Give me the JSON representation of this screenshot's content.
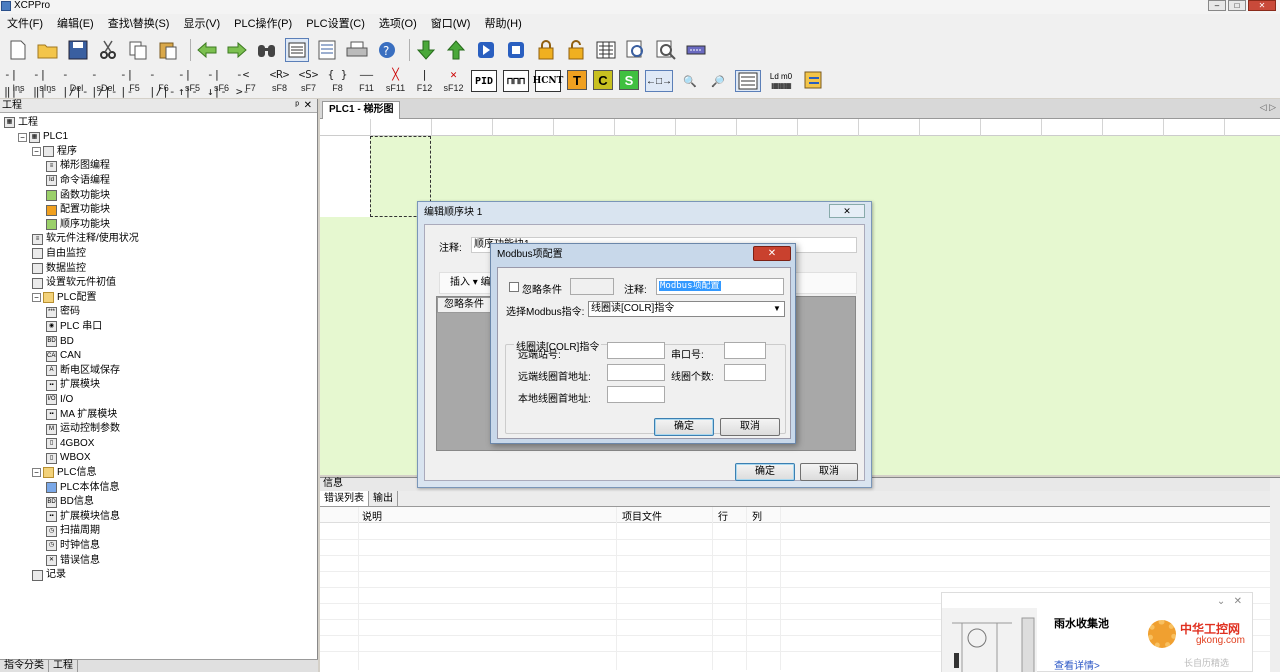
{
  "window": {
    "title": "XCPPro"
  },
  "menu": [
    "文件(F)",
    "编辑(E)",
    "查找\\替换(S)",
    "显示(V)",
    "PLC操作(P)",
    "PLC设置(C)",
    "选项(O)",
    "窗口(W)",
    "帮助(H)"
  ],
  "toolbar1": [
    "new-icon",
    "open-icon",
    "save-icon",
    "cut-icon",
    "copy-icon",
    "paste-icon",
    "undo-icon",
    "redo-icon",
    "find-icon",
    "ladder-icon",
    "list-icon",
    "print-icon",
    "help-icon",
    "download-icon",
    "upload-icon",
    "run-icon",
    "stop-icon",
    "lock-icon",
    "unlock-icon",
    "monitor-icon",
    "zoom-find-icon",
    "search-doc-icon",
    "comm-icon"
  ],
  "toolbar2": [
    {
      "sym": "-|‖|-",
      "key": "Ins"
    },
    {
      "sym": "-|‖|-",
      "key": "sIns"
    },
    {
      "sym": "-|/|-",
      "key": "Del"
    },
    {
      "sym": "-|/|-",
      "key": "sDel"
    },
    {
      "sym": "-| |-",
      "key": "F5"
    },
    {
      "sym": "-|/|-",
      "key": "F6"
    },
    {
      "sym": "-|↑|-",
      "key": "sF5"
    },
    {
      "sym": "-|↓|-",
      "key": "sF6"
    },
    {
      "sym": "-< >-",
      "key": "F7"
    },
    {
      "sym": "<R>",
      "key": "sF8"
    },
    {
      "sym": "<S>",
      "key": "sF7"
    },
    {
      "sym": "{ }",
      "key": "F8"
    },
    {
      "sym": "——",
      "key": "F11"
    },
    {
      "sym": "╳",
      "key": "sF11"
    },
    {
      "sym": "|",
      "key": "F12"
    },
    {
      "sym": "✕",
      "key": "sF12"
    }
  ],
  "toolbar2_extra": {
    "pid": "PID",
    "hcnt": "HCNT",
    "t": "T",
    "c": "C",
    "s": "S",
    "ld": "Ld m0"
  },
  "project_panel": {
    "title": "工程",
    "tree": [
      {
        "label": "工程",
        "level": 0,
        "icon": "project"
      },
      {
        "label": "PLC1",
        "level": 1,
        "icon": "plc",
        "toggle": "-"
      },
      {
        "label": "程序",
        "level": 2,
        "icon": "doc",
        "toggle": "-"
      },
      {
        "label": "梯形图编程",
        "level": 3,
        "icon": "ladder"
      },
      {
        "label": "命令语编程",
        "level": 3,
        "icon": "cmd"
      },
      {
        "label": "函数功能块",
        "level": 3,
        "icon": "green"
      },
      {
        "label": "配置功能块",
        "level": 3,
        "icon": "orange"
      },
      {
        "label": "顺序功能块",
        "level": 3,
        "icon": "green"
      },
      {
        "label": "软元件注释/使用状况",
        "level": 2,
        "icon": "list"
      },
      {
        "label": "自由监控",
        "level": 2,
        "icon": "doc"
      },
      {
        "label": "数据监控",
        "level": 2,
        "icon": "doc"
      },
      {
        "label": "设置软元件初值",
        "level": 2,
        "icon": "doc"
      },
      {
        "label": "PLC配置",
        "level": 2,
        "icon": "fold",
        "toggle": "-"
      },
      {
        "label": "密码",
        "level": 3,
        "icon": "pwd"
      },
      {
        "label": "PLC 串口",
        "level": 3,
        "icon": "port"
      },
      {
        "label": "BD",
        "level": 3,
        "icon": "bd"
      },
      {
        "label": "CAN",
        "level": 3,
        "icon": "can"
      },
      {
        "label": "断电区域保存",
        "level": 3,
        "icon": "save"
      },
      {
        "label": "扩展模块",
        "level": 3,
        "icon": "ext"
      },
      {
        "label": "I/O",
        "level": 3,
        "icon": "io"
      },
      {
        "label": "MA 扩展模块",
        "level": 3,
        "icon": "ext"
      },
      {
        "label": "运动控制参数",
        "level": 3,
        "icon": "m"
      },
      {
        "label": "4GBOX",
        "level": 3,
        "icon": "box"
      },
      {
        "label": "WBOX",
        "level": 3,
        "icon": "box"
      },
      {
        "label": "PLC信息",
        "level": 2,
        "icon": "fold",
        "toggle": "-"
      },
      {
        "label": "PLC本体信息",
        "level": 3,
        "icon": "blue"
      },
      {
        "label": "BD信息",
        "level": 3,
        "icon": "bd"
      },
      {
        "label": "扩展模块信息",
        "level": 3,
        "icon": "ext"
      },
      {
        "label": "扫描周期",
        "level": 3,
        "icon": "clock"
      },
      {
        "label": "时钟信息",
        "level": 3,
        "icon": "clock"
      },
      {
        "label": "错误信息",
        "level": 3,
        "icon": "err"
      },
      {
        "label": "记录",
        "level": 2,
        "icon": "doc"
      }
    ],
    "bottom_tabs": [
      "指令分类",
      "工程"
    ]
  },
  "editor": {
    "tab": "PLC1 - 梯形图"
  },
  "info_panel": {
    "title": "信息",
    "tabs": [
      "错误列表",
      "输出"
    ],
    "columns": [
      "说明",
      "项目文件",
      "行",
      "列"
    ]
  },
  "dialog_outer": {
    "title": "编辑顺序块 1",
    "comment_label": "注释:",
    "comment_value": "顺序功能块1",
    "insert_label": "插入 ▾  编",
    "list_header": "忽略条件",
    "ok": "确定",
    "cancel": "取消"
  },
  "dialog_modbus": {
    "title": "Modbus项配置",
    "ignore_label": "忽略条件",
    "comment_label": "注释:",
    "comment_value": "Modbus项配置",
    "select_label": "选择Modbus指令:",
    "select_value": "线圈读[COLR]指令",
    "group_title": "线圈读[COLR]指令",
    "remote_station": "远端站号:",
    "serial_port": "串口号:",
    "remote_coil_addr": "远端线圈首地址:",
    "coil_count": "线圈个数:",
    "local_coil_addr": "本地线圈首地址:",
    "ok": "确定",
    "cancel": "取消"
  },
  "ad": {
    "title": "雨水收集池",
    "link": "查看详情>"
  },
  "watermark": {
    "cn": "中华工控网",
    "en": "gkong.com",
    "sub": "长自历精选"
  },
  "colors": {
    "ladder_bg": "#e6f8d0",
    "dialog_frame": "#c8d8ea",
    "close_red": "#c9412e"
  }
}
